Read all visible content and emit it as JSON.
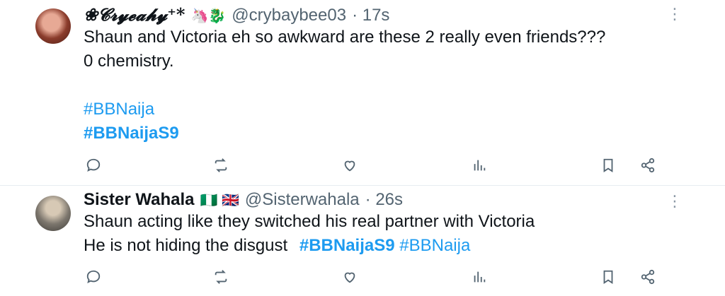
{
  "tweets": [
    {
      "display_name": "❀𝓒𝓻𝔂𝓮𝓪𝓱𝔂⁺*",
      "name_emojis": "🦄🐉",
      "handle": "@crybaybee03",
      "time": "17s",
      "lines": [
        "Shaun and Victoria eh so awkward are these 2 really even friends???",
        "0 chemistry."
      ],
      "hashtags": [
        "#BBNaija",
        "#BBNaijaS9"
      ]
    },
    {
      "display_name": "Sister Wahala",
      "name_emojis": "🇳🇬 🇬🇧",
      "handle": "@Sisterwahala",
      "time": "26s",
      "lines": [
        "Shaun acting like they switched his real partner with Victoria",
        "He is not hiding the disgust"
      ],
      "hashtags": [
        "#BBNaijaS9",
        "#BBNaija"
      ]
    }
  ]
}
